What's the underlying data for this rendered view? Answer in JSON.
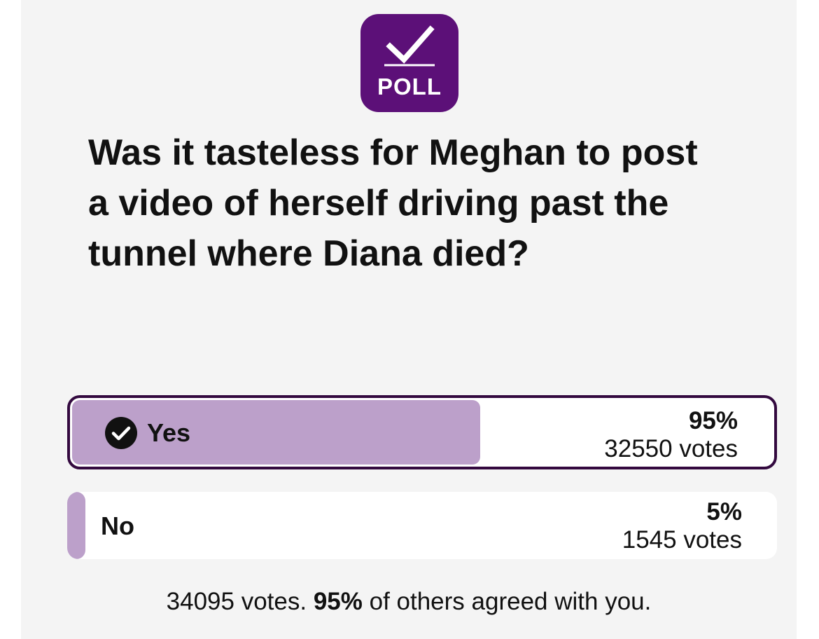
{
  "logo": {
    "text": "POLL",
    "icon": "check-mark-icon",
    "color": "#5c1078"
  },
  "question": "Was it tasteless for Meghan to post a video of herself driving past the tunnel where Diana died?",
  "options": [
    {
      "label": "Yes",
      "percent_label": "95%",
      "votes_label": "32550 votes",
      "fill_fraction": 0.58,
      "selected": true,
      "selected_icon": "check-circle-icon"
    },
    {
      "label": "No",
      "percent_label": "5%",
      "votes_label": "1545 votes",
      "fill_fraction": 0.02,
      "selected": false
    }
  ],
  "summary": {
    "total": "34095 votes.",
    "agree_pct": "95%",
    "agree_text": "of others agreed with you."
  },
  "colors": {
    "brand": "#5c1078",
    "bar_fill": "#bca0ca",
    "selected_border": "#33093f",
    "background": "#f4f4f4"
  }
}
